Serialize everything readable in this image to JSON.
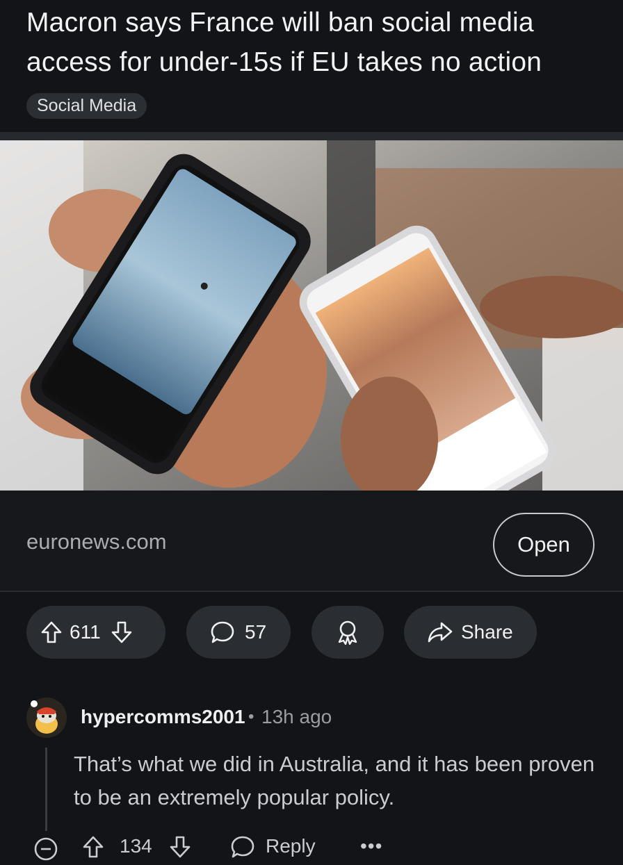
{
  "post": {
    "title": "Macron says France will ban social media access for under-15s if EU takes no action",
    "flair": "Social Media",
    "link": {
      "domain": "euronews.com",
      "open_label": "Open"
    },
    "image_description_icon": "photo-two-phones",
    "actions": {
      "upvotes": "611",
      "comments": "57",
      "share_label": "Share"
    }
  },
  "comment": {
    "username": "hypercomms2001",
    "separator": "•",
    "time": "13h ago",
    "body": "That’s what we did in Australia, and it has been proven to be an extremely popular policy.",
    "votes": "134",
    "reply_label": "Reply",
    "more": "•••"
  },
  "colors": {
    "background": "#121417",
    "pill": "#2a2d31",
    "text_primary": "#f0f1f2",
    "text_secondary": "#9a9da1"
  }
}
